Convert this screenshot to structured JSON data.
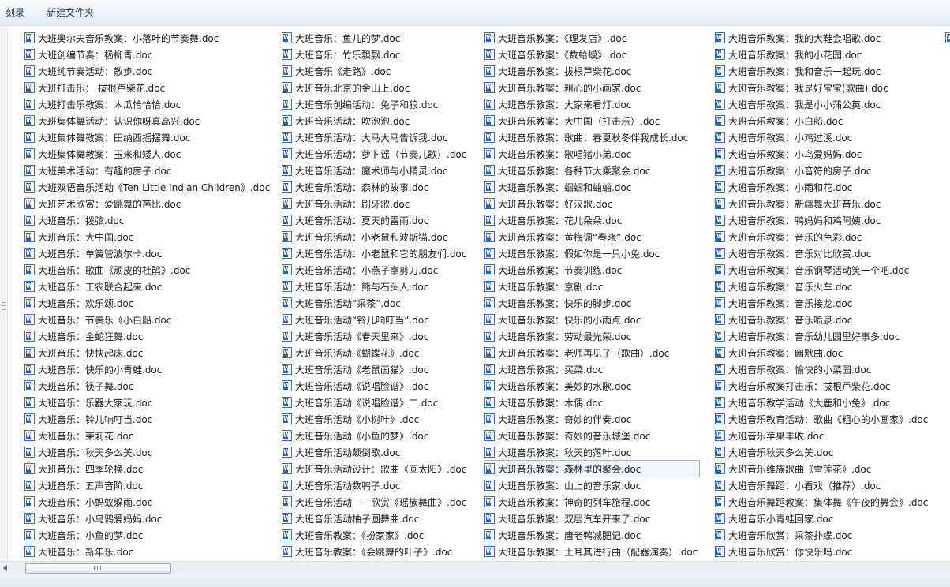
{
  "toolbar": {
    "burn_label": "刻录",
    "new_folder_label": "新建文件夹"
  },
  "columns": [
    [
      "大班奥尔夫音乐教案：小落叶的节奏舞.doc",
      "大班创编节奏：杨柳青.doc",
      "大班纯节奏活动：散步.doc",
      "大班打击乐： 拔根芦柴花.doc",
      "大班打击乐教案：木瓜恰恰恰.doc",
      "大班集体舞活动：认识你呀真高兴.doc",
      "大班集体舞教案：田纳西摇摆舞.doc",
      "大班集体舞教案：玉米和矮人.doc",
      "大班美术活动：有趣的房子.doc",
      "大班双语音乐活动《Ten Little Indian Children》.doc",
      "大班艺术欣赏：爱跳舞的芭比.doc",
      "大班音乐：拨弦.doc",
      "大班音乐：大中国.doc",
      "大班音乐：单簧管波尔卡.doc",
      "大班音乐：歌曲《顽皮的杜鹃》.doc",
      "大班音乐：工农联合起来.doc",
      "大班音乐：欢乐颂.doc",
      "大班音乐：节奏乐《小白船.doc",
      "大班音乐：金蛇狂舞.doc",
      "大班音乐：快快起床.doc",
      "大班音乐：快乐的小青蛙.doc",
      "大班音乐：筷子舞.doc",
      "大班音乐：乐器大家玩.doc",
      "大班音乐：铃儿响叮当.doc",
      "大班音乐：茉莉花.doc",
      "大班音乐：秋天多么美.doc",
      "大班音乐：四季轮换.doc",
      "大班音乐：五声音阶.doc",
      "大班音乐：小蚂蚁躲雨.doc",
      "大班音乐：小乌鸦爱妈妈.doc",
      "大班音乐：小鱼的梦.doc",
      "大班音乐：新年乐.doc"
    ],
    [
      "大班音乐：鱼儿的梦.doc",
      "大班音乐：竹乐飘飘.doc",
      "大班音乐《走路》.doc",
      "大班音乐北京的金山上.doc",
      "大班音乐创编活动：兔子和狼.doc",
      "大班音乐活动：吹泡泡.doc",
      "大班音乐活动：大马大马告诉我.doc",
      "大班音乐活动：萝卜谣（节奏儿歌）.doc",
      "大班音乐活动：魔术师与小精灵.doc",
      "大班音乐活动：森林的故事.doc",
      "大班音乐活动：刷牙歌.doc",
      "大班音乐活动：夏天的雷雨.doc",
      "大班音乐活动：小老鼠和波斯猫.doc",
      "大班音乐活动：小老鼠和它的朋友们.doc",
      "大班音乐活动：小燕子拿剪刀.doc",
      "大班音乐活动：熊与石头人.doc",
      "大班音乐活动“采茶”.doc",
      "大班音乐活动“铃儿响叮当”.doc",
      "大班音乐活动《春天里来》.doc",
      "大班音乐活动《蝴蝶花》.doc",
      "大班音乐活动《老鼠画猫》.doc",
      "大班音乐活动《说唱脸谱》.doc",
      "大班音乐活动《说唱脸谱》二.doc",
      "大班音乐活动《小树叶》.doc",
      "大班音乐活动《小鱼的梦》.doc",
      "大班音乐活动颠倒歌.doc",
      "大班音乐活动设计：歌曲《画太阳》.doc",
      "大班音乐活动数鸭子.doc",
      "大班音乐活动——欣赏《瑶族舞曲》.doc",
      "大班音乐活动柚子圆舞曲.doc",
      "大班音乐教案：《扮家家》.doc",
      "大班音乐教案：《会跳舞的叶子》.doc"
    ],
    [
      "大班音乐教案：《理发店》.doc",
      "大班音乐教案：《数蛤蟆》.doc",
      "大班音乐教案：拔根芦柴花.doc",
      "大班音乐教案：粗心的小画家.doc",
      "大班音乐教案：大家来看灯.doc",
      "大班音乐教案：大中国（打击乐）.doc",
      "大班音乐教案：歌曲：春夏秋冬伴我成长.doc",
      "大班音乐教案：歌唱猪小弟.doc",
      "大班音乐教案：各种节大乘聚会.doc",
      "大班音乐教案：蝈蝈和蛐蛐.doc",
      "大班音乐教案：好汉歌.doc",
      "大班音乐教案：花儿朵朵.doc",
      "大班音乐教案：黄梅调“春晓”.doc",
      "大班音乐教案：假如你是一只小兔.doc",
      "大班音乐教案：节奏训练.doc",
      "大班音乐教案：京剧.doc",
      "大班音乐教案：快乐的脚步.doc",
      "大班音乐教案：快乐的小雨点.doc",
      "大班音乐教案：劳动最光荣.doc",
      "大班音乐教案：老师再见了（歌曲）.doc",
      "大班音乐教案：买菜.doc",
      "大班音乐教案：美妙的水歌.doc",
      "大班音乐教案：木偶.doc",
      "大班音乐教案：奇妙的伴奏.doc",
      "大班音乐教案：奇妙的音乐城堡.doc",
      "大班音乐教案：秋天的落叶.doc",
      "大班音乐教案：森林里的聚会.doc",
      "大班音乐教案：山上的音乐家.doc",
      "大班音乐教案：神奇的列车旅程.doc",
      "大班音乐教案：双层汽车开来了.doc",
      "大班音乐教案：唐老鸭减肥记.doc",
      "大班音乐教案：土耳其进行曲（配器演奏）.doc"
    ],
    [
      "大班音乐教案：我的大鞋会唱歌.doc",
      "大班音乐教案：我的小花园.doc",
      "大班音乐教案：我和音乐一起玩.doc",
      "大班音乐教案：我是好宝宝(歌曲).doc",
      "大班音乐教案：我是小小蒲公英.doc",
      "大班音乐教案：小白船.doc",
      "大班音乐教案：小鸡过溪.doc",
      "大班音乐教案：小鸟爱妈妈.doc",
      "大班音乐教案：小音符的房子.doc",
      "大班音乐教案：小雨和花.doc",
      "大班音乐教案：新疆舞大班音乐.doc",
      "大班音乐教案：鸭妈妈和鸡阿姨.doc",
      "大班音乐教案：音乐的色彩.doc",
      "大班音乐教案：音乐对比欣赏.doc",
      "大班音乐教案：音乐钢琴活动笑一个吧.doc",
      "大班音乐教案：音乐火车.doc",
      "大班音乐教案：音乐接龙.doc",
      "大班音乐教案：音乐喷泉.doc",
      "大班音乐教案：音乐幼儿园里好事多.doc",
      "大班音乐教案：幽默曲.doc",
      "大班音乐教案：愉快的小菜园.doc",
      "大班音乐教案打击乐：拔根芦柴花.doc",
      "大班音乐教学活动《大鹿和小兔》.doc",
      "大班音乐教育活动：歌曲《粗心的小画家》.doc",
      "大班音乐苹果丰收.doc",
      "大班音乐秋天多么美.doc",
      "大班音乐维族歌曲《雪莲花》.doc",
      "大班音乐舞蹈：小看戏（推荐）.doc",
      "大班音乐舞蹈教案：集体舞《午夜的舞会》.doc",
      "大班音乐小青蛙回家.doc",
      "大班音乐欣赏：采茶扑蝶.doc",
      "大班音乐欣赏：你快乐吗.doc"
    ]
  ],
  "selected": {
    "column": 2,
    "row": 26
  },
  "icon": "word-doc-icon"
}
